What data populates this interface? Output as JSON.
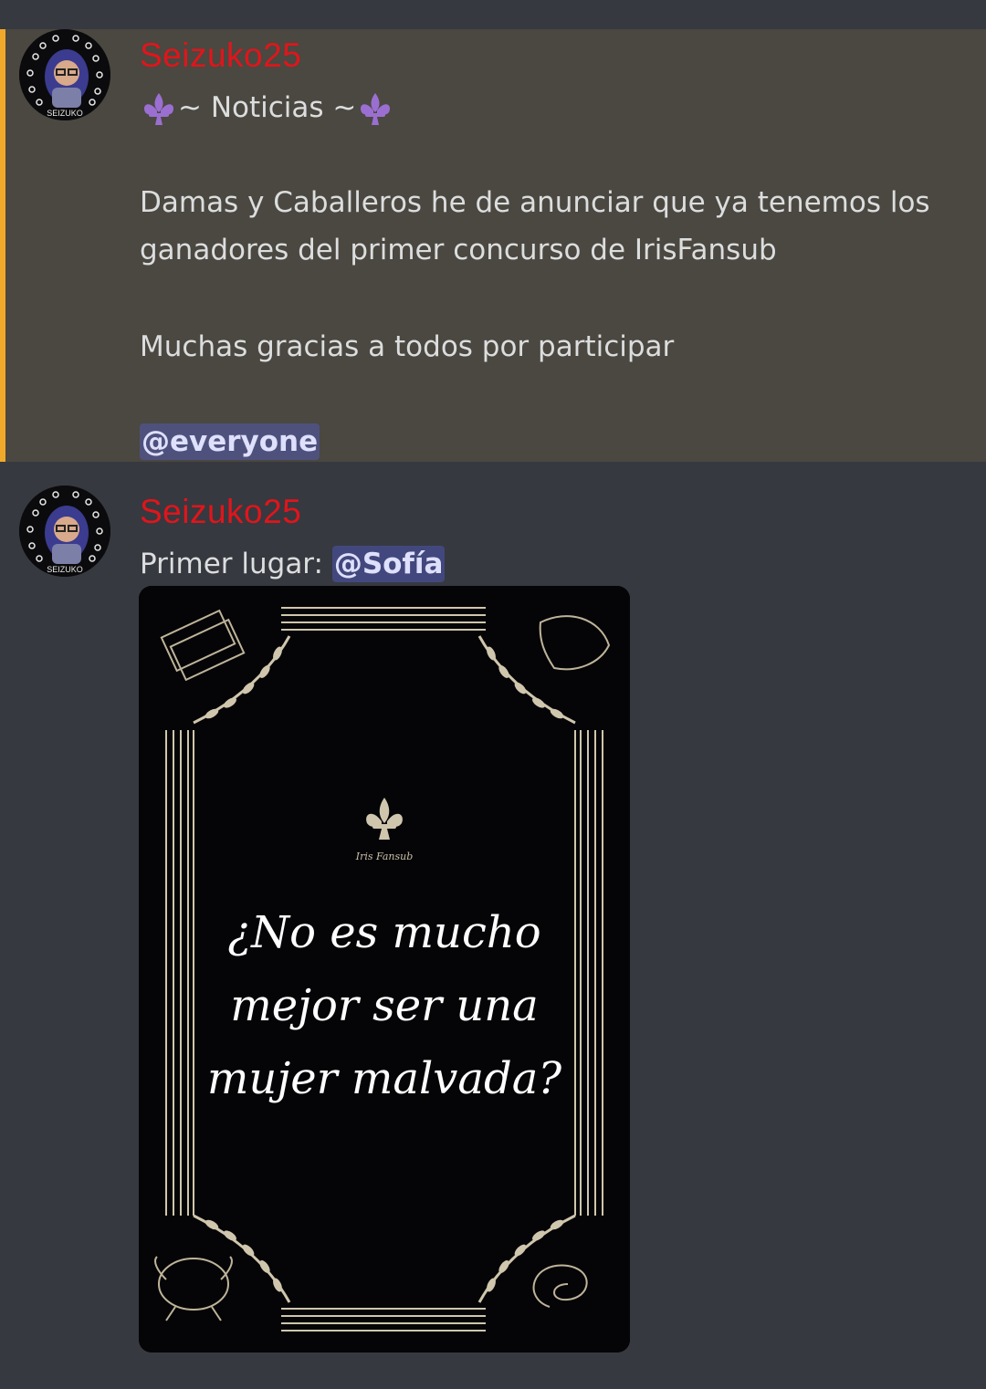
{
  "messages": [
    {
      "author": "Seizuko25",
      "title": "~ Noticias ~",
      "paragraph1_line1": "Damas y Caballeros he de anunciar que ya tenemos los",
      "paragraph1_line2": "ganadores del primer concurso de IrisFansub",
      "paragraph2": "Muchas gracias a todos por participar",
      "mention": "@everyone",
      "avatar_badge": "SEIZUKO"
    },
    {
      "author": "Seizuko25",
      "text": "Primer lugar: ",
      "mention": "@Sofía",
      "avatar_badge": "SEIZUKO",
      "attachment": {
        "brand": "Iris Fansub",
        "quote_line1": "¿No es mucho",
        "quote_line2": "mejor ser una",
        "quote_line3": "mujer malvada?"
      }
    }
  ],
  "colors": {
    "background": "#36393f",
    "highlight": "#4a4840",
    "accent": "#f0a92b",
    "username": "#e0151b",
    "mention_bg": "#5865f2"
  }
}
